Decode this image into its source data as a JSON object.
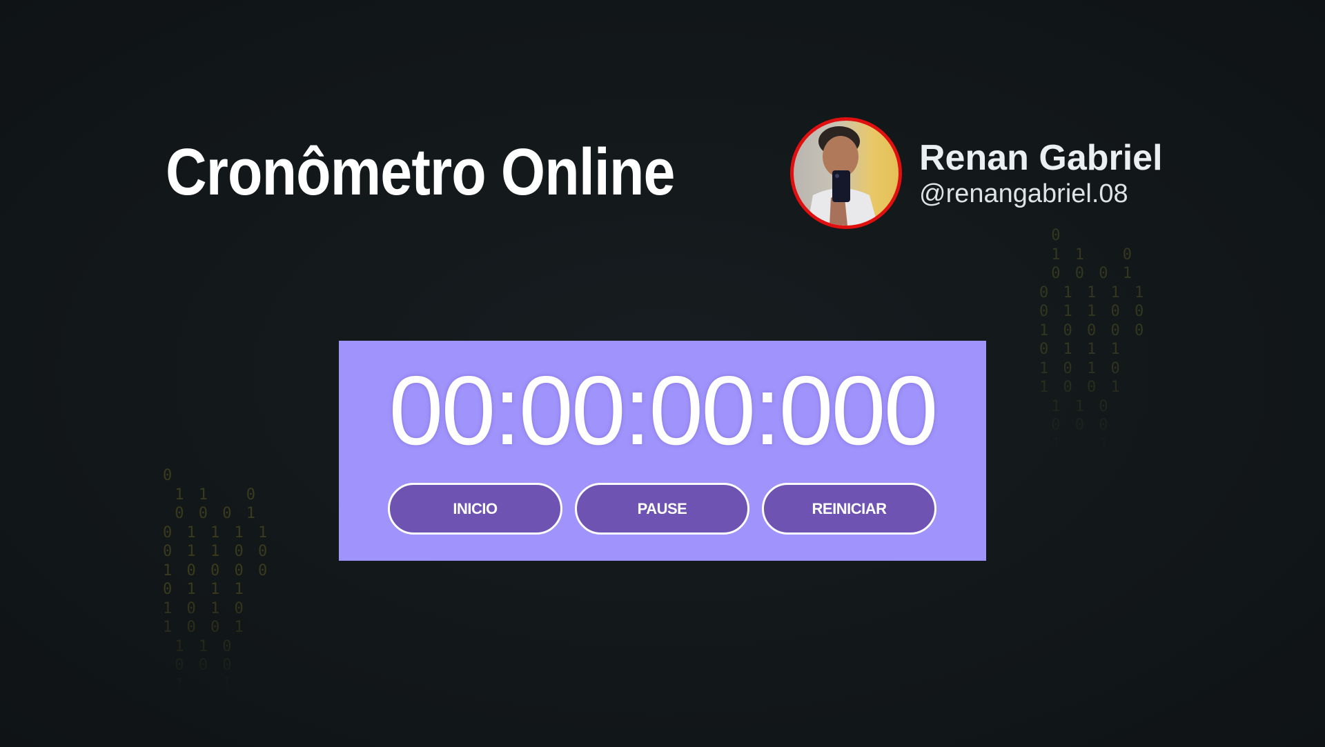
{
  "header": {
    "title": "Cronômetro Online"
  },
  "profile": {
    "name": "Renan Gabriel",
    "handle": "@renangabriel.08"
  },
  "decor": {
    "binary_left": "0\n 1 1   0\n 0 0 0 1\n0 1 1 1 1\n0 1 1 0 0\n1 0 0 0 0\n0 1 1 1\n1 0 1 0\n1 0 0 1\n 1 1 0\n 0 0 0\n 1   1",
    "binary_right": " 0\n 1 1   0\n 0 0 0 1\n0 1 1 1 1\n0 1 1 0 0\n1 0 0 0 0\n0 1 1 1\n1 0 1 0\n1 0 0 1\n 1 1 0\n 0 0 0\n 1   1"
  },
  "stopwatch": {
    "display": "00:00:00:000",
    "buttons": {
      "start": "INICIO",
      "pause": "PAUSE",
      "reset": "REINICIAR"
    }
  },
  "colors": {
    "background": "#121719",
    "panel": "#a093fb",
    "button": "#6e53b2",
    "avatar_border": "#e01010"
  }
}
